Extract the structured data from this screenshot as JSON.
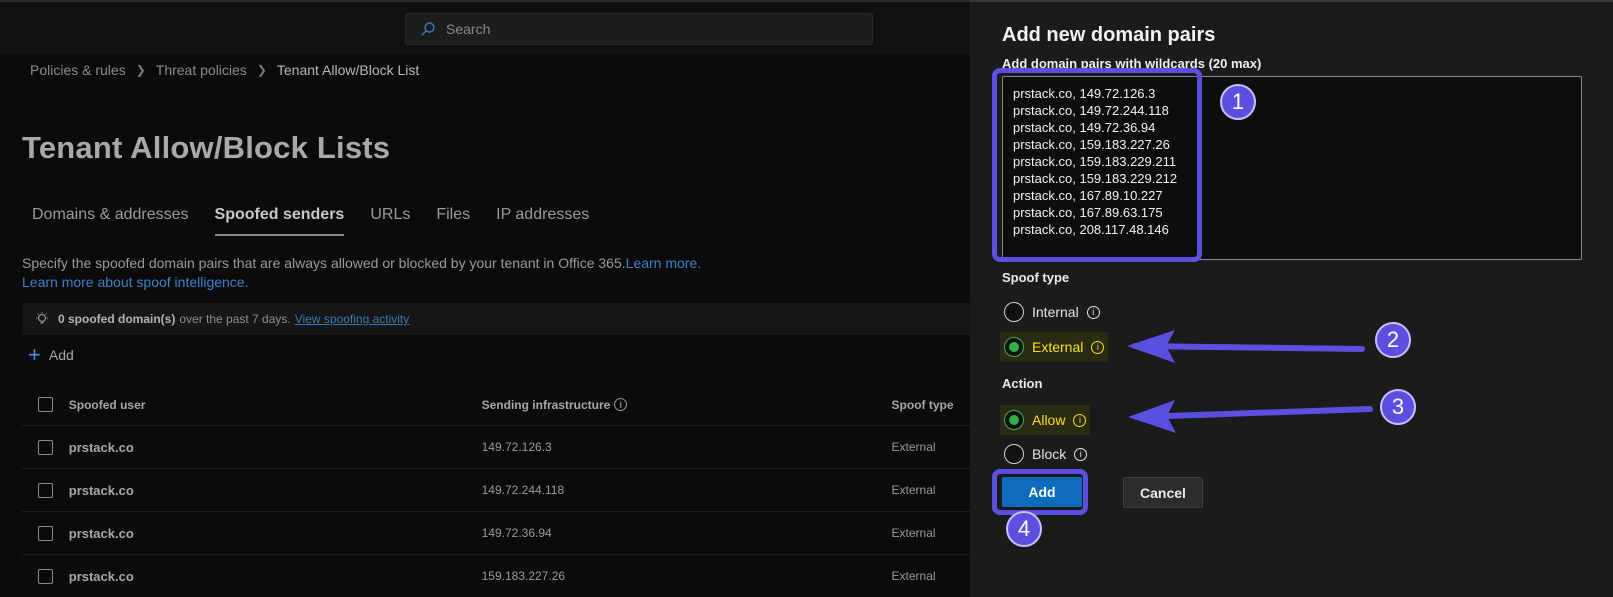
{
  "search": {
    "placeholder": "Search"
  },
  "breadcrumb": [
    "Policies & rules",
    "Threat policies",
    "Tenant Allow/Block List"
  ],
  "page_title": "Tenant Allow/Block Lists",
  "tabs": [
    {
      "label": "Domains & addresses",
      "active": false
    },
    {
      "label": "Spoofed senders",
      "active": true
    },
    {
      "label": "URLs",
      "active": false
    },
    {
      "label": "Files",
      "active": false
    },
    {
      "label": "IP addresses",
      "active": false
    }
  ],
  "description": {
    "text": "Specify the spoofed domain pairs that are always allowed or blocked by your tenant in Office 365.",
    "learn_more": "Learn more.",
    "learn_more_spoof": "Learn more about spoof intelligence."
  },
  "banner": {
    "count_text": "0 spoofed domain(s)",
    "period_text": "over the past 7 days.",
    "link": "View spoofing activity"
  },
  "toolbar": {
    "add_label": "Add"
  },
  "table": {
    "headers": [
      "Spoofed user",
      "Sending infrastructure",
      "Spoof type"
    ],
    "rows": [
      [
        "prstack.co",
        "149.72.126.3",
        "External"
      ],
      [
        "prstack.co",
        "149.72.244.118",
        "External"
      ],
      [
        "prstack.co",
        "149.72.36.94",
        "External"
      ],
      [
        "prstack.co",
        "159.183.227.26",
        "External"
      ]
    ]
  },
  "panel": {
    "title": "Add new domain pairs",
    "field_label": "Add domain pairs with wildcards (20 max)",
    "domain_pairs": [
      "prstack.co, 149.72.126.3",
      "prstack.co, 149.72.244.118",
      "prstack.co, 149.72.36.94",
      "prstack.co, 159.183.227.26",
      "prstack.co, 159.183.229.211",
      "prstack.co, 159.183.229.212",
      "prstack.co, 167.89.10.227",
      "prstack.co, 167.89.63.175",
      "prstack.co, 208.117.48.146"
    ],
    "spoof_type_label": "Spoof type",
    "spoof_types": [
      {
        "label": "Internal",
        "selected": false
      },
      {
        "label": "External",
        "selected": true
      }
    ],
    "action_label": "Action",
    "actions": [
      {
        "label": "Allow",
        "selected": true
      },
      {
        "label": "Block",
        "selected": false
      }
    ],
    "add_button": "Add",
    "cancel_button": "Cancel"
  },
  "annotations": [
    "1",
    "2",
    "3",
    "4"
  ],
  "colors": {
    "annotation": "#5b4fe0",
    "primary_button": "#0f6cbd",
    "selected_radio": "#31b14a",
    "highlight_text": "#f4e11b",
    "link": "#3b82c8"
  }
}
